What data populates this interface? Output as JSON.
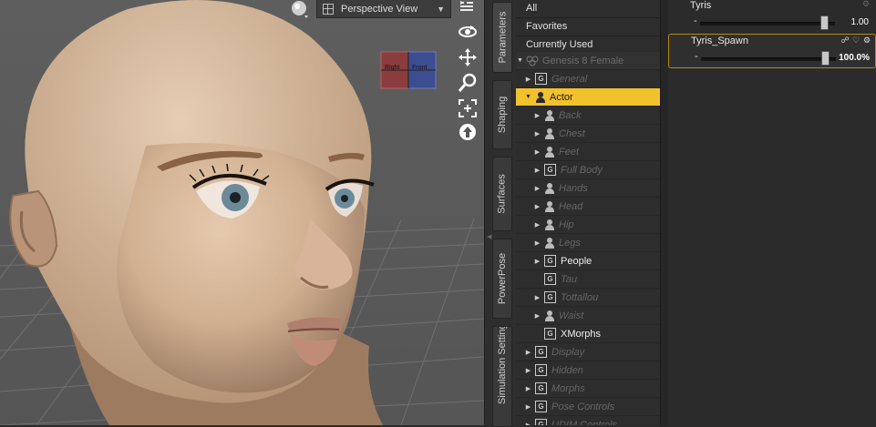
{
  "viewport": {
    "camera_label": "Perspective View",
    "cube_labels": {
      "left": "Right",
      "right": "Front"
    },
    "tools": [
      "orbit-icon",
      "pan-icon",
      "zoom-icon",
      "frame-icon",
      "reset-icon"
    ]
  },
  "side_tabs": [
    "Parameters",
    "Shaping",
    "Surfaces",
    "PowerPose",
    "Simulation Settings"
  ],
  "tree": {
    "top": [
      "All",
      "Favorites",
      "Currently Used"
    ],
    "root": "Genesis 8 Female",
    "rows": [
      {
        "label": "General",
        "icon": "group",
        "depth": 1,
        "arrow": "right",
        "style": "dim"
      },
      {
        "label": "Actor",
        "icon": "person",
        "depth": 1,
        "arrow": "down",
        "style": "selected"
      },
      {
        "label": "Back",
        "icon": "person",
        "depth": 2,
        "arrow": "right",
        "style": "dim"
      },
      {
        "label": "Chest",
        "icon": "person",
        "depth": 2,
        "arrow": "right",
        "style": "dim"
      },
      {
        "label": "Feet",
        "icon": "person",
        "depth": 2,
        "arrow": "right",
        "style": "dim"
      },
      {
        "label": "Full Body",
        "icon": "group",
        "depth": 2,
        "arrow": "right",
        "style": "dim"
      },
      {
        "label": "Hands",
        "icon": "person",
        "depth": 2,
        "arrow": "right",
        "style": "dim"
      },
      {
        "label": "Head",
        "icon": "person",
        "depth": 2,
        "arrow": "right",
        "style": "dim"
      },
      {
        "label": "Hip",
        "icon": "person",
        "depth": 2,
        "arrow": "right",
        "style": "dim"
      },
      {
        "label": "Legs",
        "icon": "person",
        "depth": 2,
        "arrow": "right",
        "style": "dim"
      },
      {
        "label": "People",
        "icon": "group",
        "depth": 2,
        "arrow": "right",
        "style": "bright"
      },
      {
        "label": "Tau",
        "icon": "group",
        "depth": 2,
        "arrow": "",
        "style": "dim"
      },
      {
        "label": "Tottallou",
        "icon": "group",
        "depth": 2,
        "arrow": "right",
        "style": "dim"
      },
      {
        "label": "Waist",
        "icon": "person",
        "depth": 2,
        "arrow": "right",
        "style": "dim"
      },
      {
        "label": "XMorphs",
        "icon": "group",
        "depth": 2,
        "arrow": "",
        "style": "bright"
      },
      {
        "label": "Display",
        "icon": "group",
        "depth": 1,
        "arrow": "right",
        "style": "dim"
      },
      {
        "label": "Hidden",
        "icon": "group",
        "depth": 1,
        "arrow": "right",
        "style": "dim"
      },
      {
        "label": "Morphs",
        "icon": "group",
        "depth": 1,
        "arrow": "right",
        "style": "dim"
      },
      {
        "label": "Pose Controls",
        "icon": "group",
        "depth": 1,
        "arrow": "right",
        "style": "dim"
      },
      {
        "label": "UDIM Controls",
        "icon": "group",
        "depth": 1,
        "arrow": "right",
        "style": "dim"
      }
    ]
  },
  "params": [
    {
      "name": "Tyris",
      "value": "1.00",
      "fraction": 1.0
    },
    {
      "name": "Tyris_Spawn",
      "value": "100.0%",
      "fraction": 1.0
    }
  ],
  "colors": {
    "selection": "#f2c12e",
    "param_highlight": "#b58a10"
  }
}
